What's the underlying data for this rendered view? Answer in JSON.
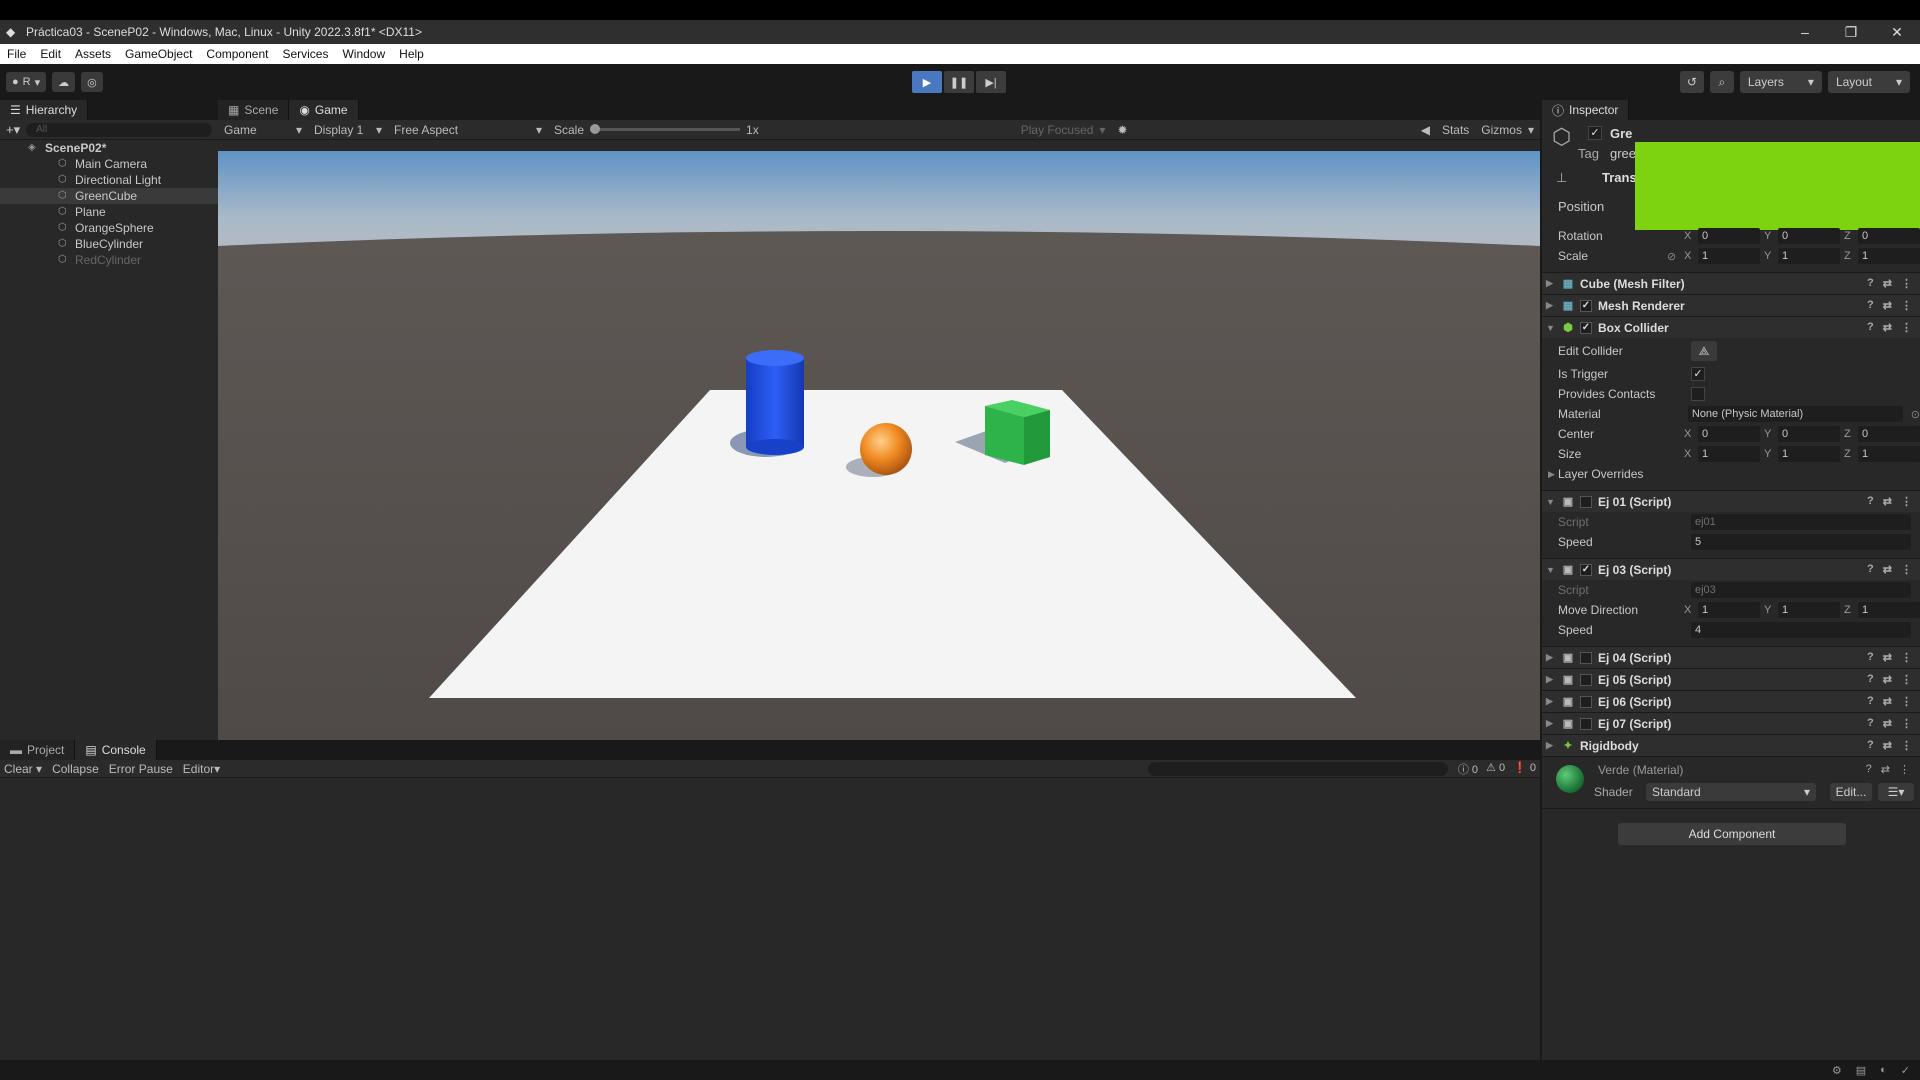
{
  "window": {
    "title": "Práctica03 - SceneP02 - Windows, Mac, Linux - Unity 2022.3.8f1* <DX11>"
  },
  "menu": [
    "File",
    "Edit",
    "Assets",
    "GameObject",
    "Component",
    "Services",
    "Window",
    "Help"
  ],
  "toolbar": {
    "account_initial": "R",
    "layers": "Layers",
    "layout": "Layout"
  },
  "hierarchy": {
    "tab": "Hierarchy",
    "search_placeholder": "All",
    "scene": "SceneP02*",
    "items": [
      "Main Camera",
      "Directional Light",
      "GreenCube",
      "Plane",
      "OrangeSphere",
      "BlueCylinder",
      "RedCylinder"
    ]
  },
  "game_view": {
    "tabs": [
      "Scene",
      "Game"
    ],
    "mode": "Game",
    "display": "Display 1",
    "aspect": "Free Aspect",
    "scale_label": "Scale",
    "scale_value": "1x",
    "play_focused": "Play Focused",
    "stats": "Stats",
    "gizmos": "Gizmos"
  },
  "console": {
    "tabs": [
      "Project",
      "Console"
    ],
    "clear": "Clear",
    "collapse": "Collapse",
    "error_pause": "Error Pause",
    "editor": "Editor",
    "counts": [
      "0",
      "0",
      "0"
    ]
  },
  "inspector": {
    "tab": "Inspector",
    "object_name": "Gre",
    "tag_label": "Tag",
    "tag_value": "gree",
    "transform": {
      "title": "Trans",
      "position_label": "Position",
      "rotation_label": "Rotation",
      "rotation": [
        "0",
        "0",
        "0"
      ],
      "scale_label": "Scale",
      "scale": [
        "1",
        "1",
        "1"
      ]
    },
    "components": {
      "mesh_filter": "Cube (Mesh Filter)",
      "mesh_renderer": "Mesh Renderer",
      "box_collider": "Box Collider"
    },
    "collider": {
      "edit_collider": "Edit Collider",
      "is_trigger": "Is Trigger",
      "provides_contacts": "Provides Contacts",
      "material_label": "Material",
      "material_value": "None (Physic Material)",
      "center_label": "Center",
      "center": [
        "0",
        "0",
        "0"
      ],
      "size_label": "Size",
      "size": [
        "1",
        "1",
        "1"
      ],
      "layer_overrides": "Layer Overrides"
    },
    "ej01": {
      "title": "Ej 01 (Script)",
      "script_label": "Script",
      "script_value": "ej01",
      "speed_label": "Speed",
      "speed": "5"
    },
    "ej03": {
      "title": "Ej 03 (Script)",
      "script_label": "Script",
      "script_value": "ej03",
      "move_label": "Move Direction",
      "move": [
        "1",
        "1",
        "1"
      ],
      "speed_label": "Speed",
      "speed": "4"
    },
    "scripts_collapsed": [
      "Ej 04 (Script)",
      "Ej 05 (Script)",
      "Ej 06 (Script)",
      "Ej 07 (Script)"
    ],
    "rigidbody": "Rigidbody",
    "material": {
      "name": "Verde (Material)",
      "shader_label": "Shader",
      "shader_value": "Standard",
      "edit": "Edit..."
    },
    "add_component": "Add Component"
  },
  "axis_labels": [
    "X",
    "Y",
    "Z"
  ],
  "colors": {
    "accent": "#4a78c0",
    "material_green": "#7dd30f",
    "cube": "#2db34a",
    "sphere": "#f08a22",
    "cylinder": "#1f4fe0"
  }
}
